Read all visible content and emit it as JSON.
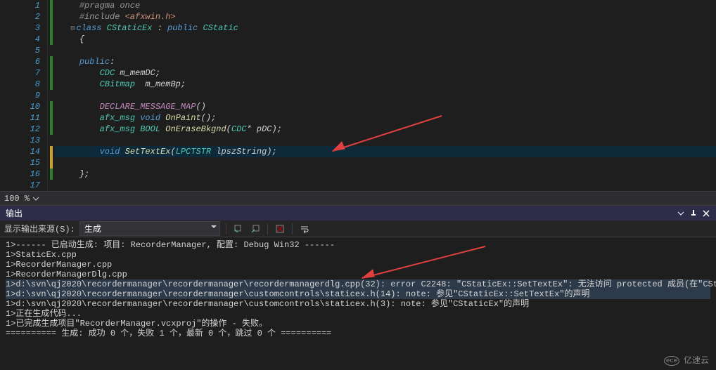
{
  "gutter": [
    "1",
    "2",
    "3",
    "4",
    "5",
    "6",
    "7",
    "8",
    "9",
    "10",
    "11",
    "12",
    "13",
    "14",
    "15",
    "16",
    "17"
  ],
  "code": {
    "l1a": "#pragma",
    "l1b": " once",
    "l2a": "#include",
    "l2b": " <afxwin.h>",
    "l3f": "⊟",
    "l3a": "class ",
    "l3b": "CStaticEx",
    "l3c": " : ",
    "l3d": "public ",
    "l3e": "CStatic",
    "l4": "{",
    "l6a": "public",
    "l6b": ":",
    "l7a": "CDC",
    "l7b": " m_memDC;",
    "l8a": "CBitmap",
    "l8b": "  m_memBp;",
    "l10a": "DECLARE_MESSAGE_MAP",
    "l10b": "()",
    "l11a": "afx_msg",
    "l11b": " ",
    "l11c": "void",
    "l11d": " ",
    "l11e": "OnPaint",
    "l11f": "();",
    "l12a": "afx_msg",
    "l12b": " ",
    "l12c": "BOOL",
    "l12d": " ",
    "l12e": "OnEraseBkgnd",
    "l12f": "(",
    "l12g": "CDC",
    "l12h": "* pDC);",
    "l14a": "void",
    "l14b": " ",
    "l14c": "SetTextEx",
    "l14d": "(",
    "l14e": "LPCTSTR",
    "l14f": " lpszString);",
    "l16": "};"
  },
  "zoom": {
    "value": "100 %"
  },
  "panel": {
    "title": "输出"
  },
  "toolbar": {
    "label": "显示输出来源(S):",
    "source": "生成"
  },
  "output": {
    "l1": "1>------ 已启动生成: 项目: RecorderManager, 配置: Debug Win32 ------",
    "l2": "1>StaticEx.cpp",
    "l3": "1>RecorderManager.cpp",
    "l4": "1>RecorderManagerDlg.cpp",
    "l5": "1>d:\\svn\\qj2020\\recordermanager\\recordermanager\\recordermanagerdlg.cpp(32): error C2248: \"CStaticEx::SetTextEx\": 无法访问 protected 成员(在\"CStaticEx\"类中声明)",
    "l6": "1>d:\\svn\\qj2020\\recordermanager\\recordermanager\\customcontrols\\staticex.h(14): note: 参见\"CStaticEx::SetTextEx\"的声明",
    "l7": "1>d:\\svn\\qj2020\\recordermanager\\recordermanager\\customcontrols\\staticex.h(3): note: 参见\"CStaticEx\"的声明",
    "l8": "1>正在生成代码...",
    "l9": "1>已完成生成项目\"RecorderManager.vcxproj\"的操作 - 失败。",
    "l10": "========== 生成: 成功 0 个，失败 1 个，最新 0 个，跳过 0 个 =========="
  },
  "watermark": {
    "brand": "亿速云",
    "icon": "ece"
  }
}
